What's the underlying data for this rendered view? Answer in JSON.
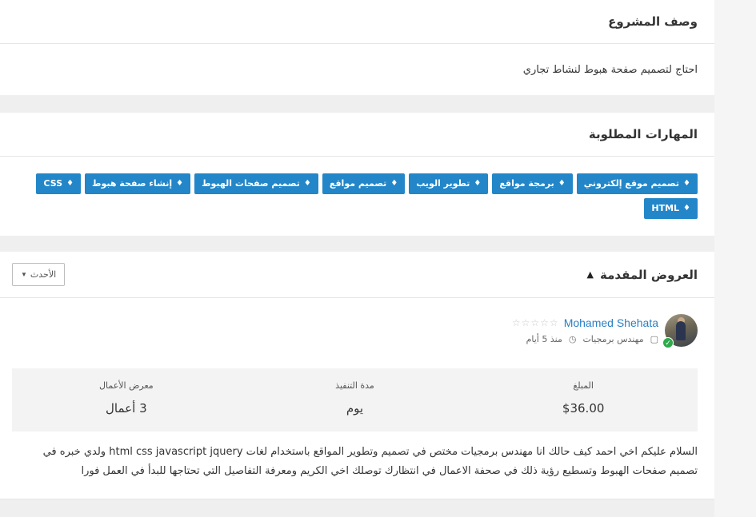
{
  "description": {
    "title": "وصف المشروع",
    "text": "احتاج لتصميم صفحة هبوط لنشاط تجاري"
  },
  "skills": {
    "title": "المهارات المطلوبة",
    "tag_icon": "tag-icon",
    "items": [
      "تصميم موقع إلكتروني",
      "برمجة مواقع",
      "تطوير الويب",
      "تصميم مواقع",
      "تصميم صفحات الهبوط",
      "إنشاء صفحة هبوط",
      "CSS",
      "HTML"
    ]
  },
  "offers": {
    "title": "العروض المقدمة",
    "sort_label": "الأحدث",
    "items": [
      {
        "name": "Mohamed Shehata",
        "rating_stars": "☆☆☆☆☆",
        "job_title": "مهندس برمجيات",
        "time": "منذ 5 أيام",
        "stats": {
          "amount_label": "المبلغ",
          "amount": "$36.00",
          "duration_label": "مدة التنفيذ",
          "duration": "يوم",
          "portfolio_label": "معرض الأعمال",
          "portfolio": "3 أعمال"
        },
        "text": "السلام عليكم اخي احمد كيف حالك انا مهندس برمجيات مختص في تصميم وتطوير المواقع باستخدام لغات html css javascript jquery ولدي خبره في تصميم صفحات الهبوط وتسطيع رؤية ذلك في صحفة الاعمال في انتظارك توصلك اخي الكريم ومعرفة التفاصيل التي تحتاجها للبدأ في العمل فورا"
      }
    ]
  },
  "colors": {
    "accent": "#2386c8",
    "link": "#2b80c5",
    "verified": "#2eaa4d",
    "page_bg": "#efefef"
  }
}
